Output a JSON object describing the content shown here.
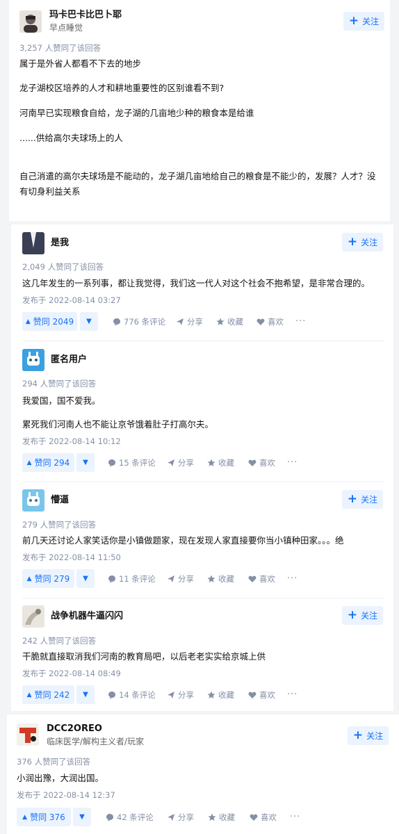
{
  "follow_label": "关注",
  "answers": [
    {
      "author": "玛卡巴卡比巴卜耶",
      "subtitle": "早点睡觉",
      "votes_meta": "3,257 人赞同了该回答",
      "paragraphs": [
        "属于是外省人都看不下去的地步",
        "龙子湖校区培养的人才和耕地重要性的区别谁看不到?",
        "河南早已实现粮食自给，龙子湖的几亩地少种的粮食本是给谁",
        "......供给高尔夫球场上的人",
        "自己消遣的高尔夫球场是不能动的，龙子湖几亩地给自己的粮食是不能少的，发展？人才？没有切身利益关系"
      ],
      "avatar_color": "#6b5a58"
    },
    {
      "author": "是我",
      "votes_meta": "2,049 人赞同了该回答",
      "text": "这几年发生的一系列事，都让我觉得，我们这一代人对这个社会不抱希望，是非常合理的。",
      "date": "发布于 2022-08-14 03:27",
      "upvote": "赞同 2049",
      "comments": "776 条评论",
      "avatar_color": "#3b3f55"
    },
    {
      "author": "匿名用户",
      "votes_meta": "294 人赞同了该回答",
      "paragraphs": [
        "我爱国，国不爱我。",
        "累死我们河南人也不能让京爷饿着肚子打高尔夫。"
      ],
      "date": "发布于 2022-08-14 10:12",
      "upvote": "赞同 294",
      "comments": "15 条评论",
      "avatar_color": "#3aa0e0"
    },
    {
      "author": "懵逼",
      "votes_meta": "279 人赞同了该回答",
      "text": "前几天还讨论人家笑话你是小镇做题家，现在发现人家直接要你当小镇种田家。。。绝",
      "date": "发布于 2022-08-14 11:50",
      "upvote": "赞同 279",
      "comments": "11 条评论",
      "avatar_color": "#79c6ea"
    },
    {
      "author": "战争机器牛逼闪闪",
      "votes_meta": "242 人赞同了该回答",
      "text": "干脆就直接取消我们河南的教育局吧，以后老老实实给京城上供",
      "date": "发布于 2022-08-14 08:49",
      "upvote": "赞同 242",
      "comments": "14 条评论",
      "avatar_color": "#b9b2a5"
    },
    {
      "author": "DCC2OREO",
      "subtitle": "临床医学/解构主义者/玩家",
      "votes_meta": "376 人赞同了该回答",
      "text": "小润出豫，大润出国。",
      "date": "发布于 2022-08-14 12:37",
      "upvote": "赞同 376",
      "comments": "42 条评论",
      "avatar_color": "#d23a26"
    }
  ],
  "actions": {
    "share": "分享",
    "collect": "收藏",
    "like": "喜欢",
    "more": "···"
  },
  "colors": {
    "accent": "#1772f6",
    "accent_bg": "#ebf3fe",
    "meta": "#8590a6"
  }
}
